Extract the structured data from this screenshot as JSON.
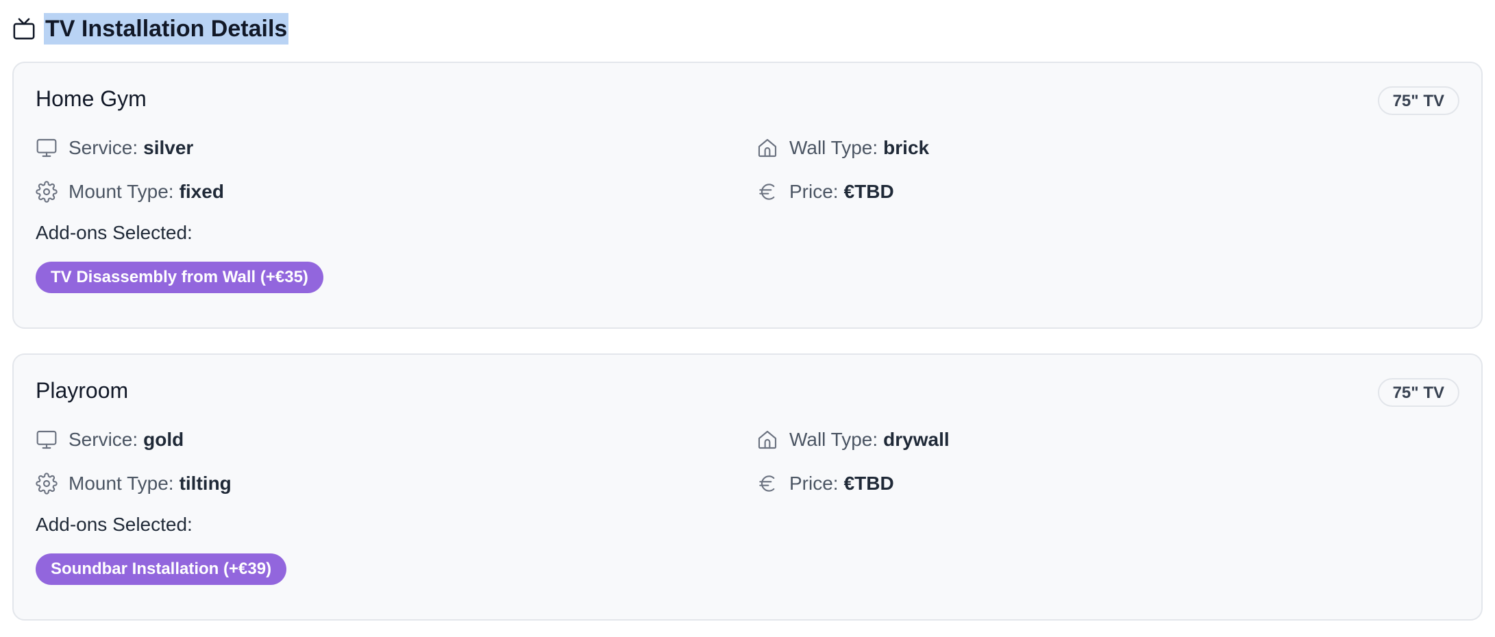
{
  "section": {
    "title": "TV Installation Details",
    "icon": "tv-icon"
  },
  "labels": {
    "service": "Service:",
    "wall_type": "Wall Type:",
    "mount_type": "Mount Type:",
    "price": "Price:",
    "addons": "Add-ons Selected:"
  },
  "colors": {
    "addon_pill": "#9266dd",
    "title_highlight": "#b9d3f4",
    "card_background": "#f8f9fb"
  },
  "rooms": [
    {
      "name": "Home Gym",
      "tv_size": "75\" TV",
      "service": "silver",
      "wall_type": "brick",
      "mount_type": "fixed",
      "price": "€TBD",
      "addons": [
        "TV Disassembly from Wall (+€35)"
      ]
    },
    {
      "name": "Playroom",
      "tv_size": "75\" TV",
      "service": "gold",
      "wall_type": "drywall",
      "mount_type": "tilting",
      "price": "€TBD",
      "addons": [
        "Soundbar Installation (+€39)"
      ]
    }
  ]
}
